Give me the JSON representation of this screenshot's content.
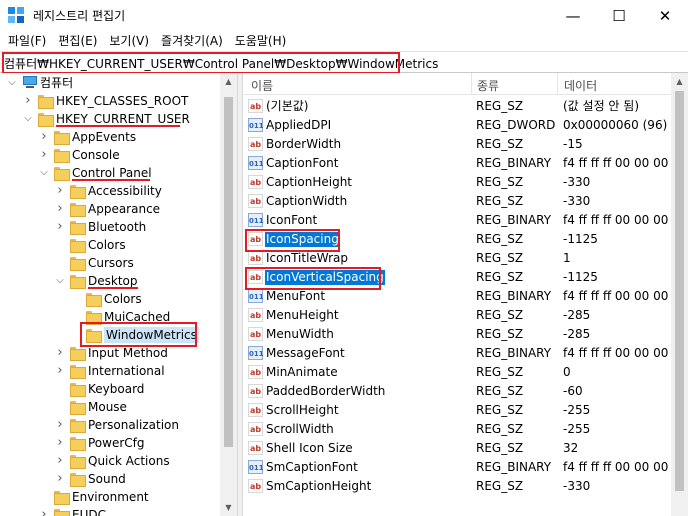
{
  "window": {
    "title": "레지스트리 편집기",
    "minimize": "—",
    "maximize": "☐",
    "close": "✕"
  },
  "menu": [
    "파일(F)",
    "편집(E)",
    "보기(V)",
    "즐겨찾기(A)",
    "도움말(H)"
  ],
  "address": "컴퓨터₩HKEY_CURRENT_USER₩Control Panel₩Desktop₩WindowMetrics",
  "tree": [
    {
      "label": "컴퓨터",
      "level": 0,
      "chevron": "expanded",
      "icon": "computer-icon"
    },
    {
      "label": "HKEY_CLASSES_ROOT",
      "level": 1,
      "chevron": "collapsed"
    },
    {
      "label": "HKEY_CURRENT_USER",
      "level": 1,
      "chevron": "expanded"
    },
    {
      "label": "AppEvents",
      "level": 2,
      "chevron": "collapsed"
    },
    {
      "label": "Console",
      "level": 2,
      "chevron": "collapsed"
    },
    {
      "label": "Control Panel",
      "level": 2,
      "chevron": "expanded"
    },
    {
      "label": "Accessibility",
      "level": 3,
      "chevron": "collapsed"
    },
    {
      "label": "Appearance",
      "level": 3,
      "chevron": "collapsed"
    },
    {
      "label": "Bluetooth",
      "level": 3,
      "chevron": "collapsed"
    },
    {
      "label": "Colors",
      "level": 3,
      "chevron": "none"
    },
    {
      "label": "Cursors",
      "level": 3,
      "chevron": "none"
    },
    {
      "label": "Desktop",
      "level": 3,
      "chevron": "expanded"
    },
    {
      "label": "Colors",
      "level": 4,
      "chevron": "none"
    },
    {
      "label": "MuiCached",
      "level": 4,
      "chevron": "none"
    },
    {
      "label": "WindowMetrics",
      "level": 4,
      "chevron": "none",
      "selected": true
    },
    {
      "label": "Input Method",
      "level": 3,
      "chevron": "collapsed"
    },
    {
      "label": "International",
      "level": 3,
      "chevron": "collapsed"
    },
    {
      "label": "Keyboard",
      "level": 3,
      "chevron": "none"
    },
    {
      "label": "Mouse",
      "level": 3,
      "chevron": "none"
    },
    {
      "label": "Personalization",
      "level": 3,
      "chevron": "collapsed"
    },
    {
      "label": "PowerCfg",
      "level": 3,
      "chevron": "collapsed"
    },
    {
      "label": "Quick Actions",
      "level": 3,
      "chevron": "collapsed"
    },
    {
      "label": "Sound",
      "level": 3,
      "chevron": "collapsed"
    },
    {
      "label": "Environment",
      "level": 2,
      "chevron": "none"
    },
    {
      "label": "EUDC",
      "level": 2,
      "chevron": "collapsed"
    }
  ],
  "list_columns": [
    "이름",
    "종류",
    "데이터"
  ],
  "values": [
    {
      "name": "(기본값)",
      "type": "REG_SZ",
      "data": "(값 설정 안 됨)",
      "icon": "string"
    },
    {
      "name": "AppliedDPI",
      "type": "REG_DWORD",
      "data": "0x00000060 (96)",
      "icon": "binary"
    },
    {
      "name": "BorderWidth",
      "type": "REG_SZ",
      "data": "-15",
      "icon": "string"
    },
    {
      "name": "CaptionFont",
      "type": "REG_BINARY",
      "data": "f4 ff ff ff 00 00 00",
      "icon": "binary"
    },
    {
      "name": "CaptionHeight",
      "type": "REG_SZ",
      "data": "-330",
      "icon": "string"
    },
    {
      "name": "CaptionWidth",
      "type": "REG_SZ",
      "data": "-330",
      "icon": "string"
    },
    {
      "name": "IconFont",
      "type": "REG_BINARY",
      "data": "f4 ff ff ff 00 00 00",
      "icon": "binary"
    },
    {
      "name": "IconSpacing",
      "type": "REG_SZ",
      "data": "-1125",
      "icon": "string",
      "selected": true
    },
    {
      "name": "IconTitleWrap",
      "type": "REG_SZ",
      "data": "1",
      "icon": "string"
    },
    {
      "name": "IconVerticalSpacing",
      "type": "REG_SZ",
      "data": "-1125",
      "icon": "string",
      "selected": true
    },
    {
      "name": "MenuFont",
      "type": "REG_BINARY",
      "data": "f4 ff ff ff 00 00 00",
      "icon": "binary"
    },
    {
      "name": "MenuHeight",
      "type": "REG_SZ",
      "data": "-285",
      "icon": "string"
    },
    {
      "name": "MenuWidth",
      "type": "REG_SZ",
      "data": "-285",
      "icon": "string"
    },
    {
      "name": "MessageFont",
      "type": "REG_BINARY",
      "data": "f4 ff ff ff 00 00 00",
      "icon": "binary"
    },
    {
      "name": "MinAnimate",
      "type": "REG_SZ",
      "data": "0",
      "icon": "string"
    },
    {
      "name": "PaddedBorderWidth",
      "type": "REG_SZ",
      "data": "-60",
      "icon": "string"
    },
    {
      "name": "ScrollHeight",
      "type": "REG_SZ",
      "data": "-255",
      "icon": "string"
    },
    {
      "name": "ScrollWidth",
      "type": "REG_SZ",
      "data": "-255",
      "icon": "string"
    },
    {
      "name": "Shell Icon Size",
      "type": "REG_SZ",
      "data": "32",
      "icon": "string"
    },
    {
      "name": "SmCaptionFont",
      "type": "REG_BINARY",
      "data": "f4 ff ff ff 00 00 00",
      "icon": "binary"
    },
    {
      "name": "SmCaptionHeight",
      "type": "REG_SZ",
      "data": "-330",
      "icon": "string"
    }
  ],
  "colors": {
    "highlight_red": "#e31b23",
    "selection_blue": "#0078d7",
    "tree_selection": "#cce4f7"
  }
}
